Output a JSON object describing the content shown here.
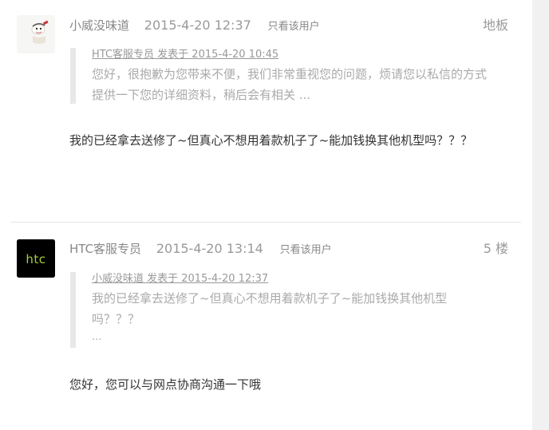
{
  "posts": [
    {
      "author": "小威没味道",
      "time": "2015-4-20 12:37",
      "only_user_label": "只看该用户",
      "floor": "地板",
      "quote": {
        "header": "HTC客服专员 发表于 2015-4-20 10:45",
        "lines": [
          "您好，很抱歉为您带来不便，我们非常重视您的问题，烦请您以私信的方式",
          "提供一下您的详细资料，稍后会有相关 ..."
        ]
      },
      "content": "我的已经拿去送修了~但真心不想用着款机子了~能加钱换其他机型吗？？？"
    },
    {
      "author": "HTC客服专员",
      "time": "2015-4-20 13:14",
      "only_user_label": "只看该用户",
      "floor": "5 楼",
      "avatar_text": "htc",
      "quote": {
        "header": "小威没味道 发表于 2015-4-20 12:37",
        "lines": [
          "我的已经拿去送修了~但真心不想用着款机子了~能加钱换其他机型",
          "吗？？？"
        ],
        "ellipsis": "..."
      },
      "content": "您好，您可以与网点协商沟通一下哦"
    }
  ],
  "colors": {
    "htc_green": "#a6ce39",
    "meta_gray": "#999999",
    "quote_bar": "#e8e8e8",
    "content_text": "#333333"
  }
}
